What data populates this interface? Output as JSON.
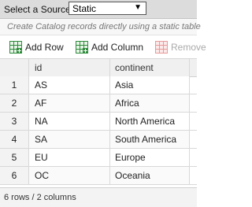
{
  "source": {
    "label": "Select a Source:",
    "selected": "Static"
  },
  "hint": "Create Catalog records directly using a static table",
  "toolbar": {
    "add_row": "Add Row",
    "add_column": "Add Column",
    "remove": "Remove"
  },
  "grid": {
    "columns": [
      "id",
      "continent"
    ],
    "rows": [
      {
        "num": "1",
        "id": "AS",
        "continent": "Asia"
      },
      {
        "num": "2",
        "id": "AF",
        "continent": "Africa"
      },
      {
        "num": "3",
        "id": "NA",
        "continent": "North America"
      },
      {
        "num": "4",
        "id": "SA",
        "continent": "South America"
      },
      {
        "num": "5",
        "id": "EU",
        "continent": "Europe"
      },
      {
        "num": "6",
        "id": "OC",
        "continent": "Oceania"
      }
    ]
  },
  "status": "6 rows / 2 columns",
  "colors": {
    "toolbar_icon_green": "#2e8b3a",
    "remove_icon_red": "#e79a9a"
  }
}
